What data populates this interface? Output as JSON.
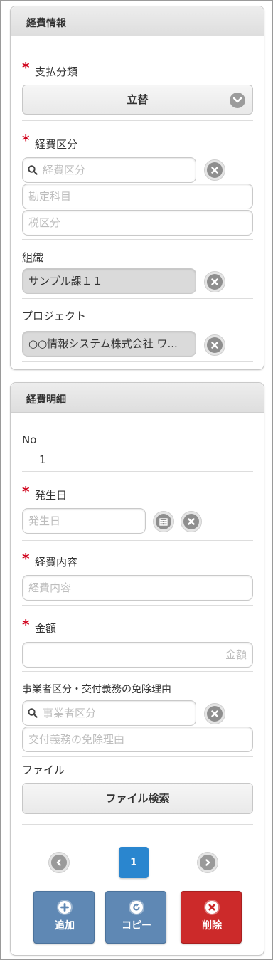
{
  "expense_info": {
    "header": "経費情報",
    "payment_category": {
      "label": "支払分類",
      "value": "立替"
    },
    "expense_category": {
      "label": "経費区分",
      "search_placeholder": "経費区分",
      "account_placeholder": "勘定科目",
      "tax_placeholder": "税区分"
    },
    "organization": {
      "label": "組織",
      "value": "サンプル課１１"
    },
    "project": {
      "label": "プロジェクト",
      "value": "○○情報システム株式会社 ワ..."
    }
  },
  "expense_detail": {
    "header": "経費明細",
    "no": {
      "label": "No",
      "value": "1"
    },
    "date": {
      "label": "発生日",
      "placeholder": "発生日"
    },
    "content": {
      "label": "経費内容",
      "placeholder": "経費内容"
    },
    "amount": {
      "label": "金額",
      "placeholder": "金額"
    },
    "business": {
      "label": "事業者区分・交付義務の免除理由",
      "search_placeholder": "事業者区分",
      "reason_placeholder": "交付義務の免除理由"
    },
    "file": {
      "label": "ファイル",
      "button": "ファイル検索"
    }
  },
  "pager": {
    "current": "1"
  },
  "actions": {
    "add": "追加",
    "copy": "コピー",
    "delete": "削除"
  },
  "colors": {
    "required": "#d0021b",
    "primary": "#2a86cf",
    "action_blue": "#5f88b4",
    "action_red": "#cc2a2a"
  }
}
